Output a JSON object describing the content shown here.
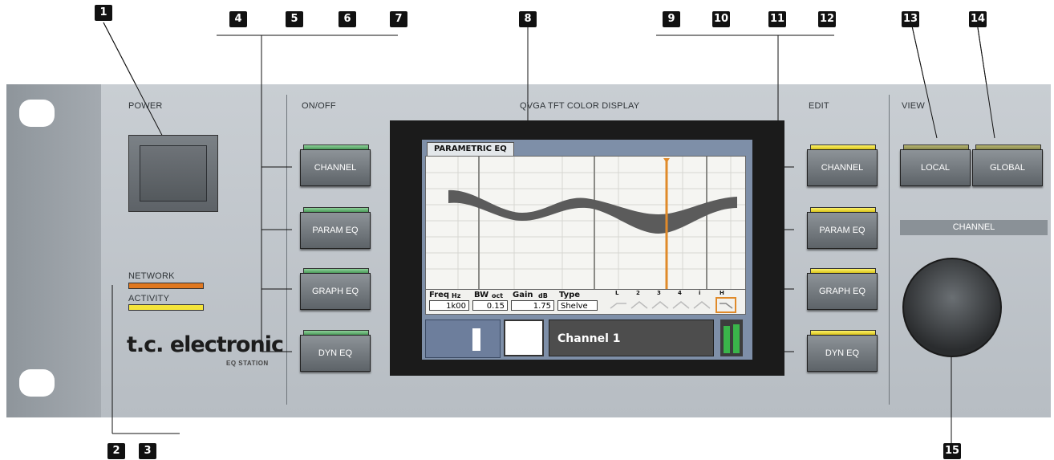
{
  "callouts": [
    "1",
    "2",
    "3",
    "4",
    "5",
    "6",
    "7",
    "8",
    "9",
    "10",
    "11",
    "12",
    "13",
    "14",
    "15"
  ],
  "labels": {
    "power": "POWER",
    "onoff": "ON/OFF",
    "display": "QVGA TFT COLOR DISPLAY",
    "edit": "EDIT",
    "view": "VIEW",
    "channel": "CHANNEL",
    "network": "NETWORK",
    "activity": "ACTIVITY"
  },
  "logo": {
    "brand": "t.c. electronic",
    "product": "EQ STATION"
  },
  "onoff_buttons": [
    "CHANNEL",
    "PARAM EQ",
    "GRAPH EQ",
    "DYN EQ"
  ],
  "edit_buttons": [
    "CHANNEL",
    "PARAM EQ",
    "GRAPH EQ",
    "DYN EQ"
  ],
  "view_buttons": [
    "LOCAL",
    "GLOBAL"
  ],
  "screen": {
    "tab": "PARAMETRIC EQ",
    "freq_label": "Freq",
    "freq_unit": "Hz",
    "freq_value": "1k00",
    "bw_label": "BW",
    "bw_unit": "oct",
    "bw_value": "0.15",
    "gain_label": "Gain",
    "gain_unit": "dB",
    "gain_value": "1.75",
    "type_label": "Type",
    "type_value": "Shelve",
    "band_labels": [
      "L",
      "2",
      "3",
      "4",
      "i",
      "H"
    ],
    "channel_name": "Channel 1"
  },
  "colors": {
    "led_green": "#5fb56d",
    "led_yellow": "#f0df2e",
    "network_led": "#e07820",
    "activity_led": "#f4e43a",
    "cursor": "#e08a2a"
  }
}
